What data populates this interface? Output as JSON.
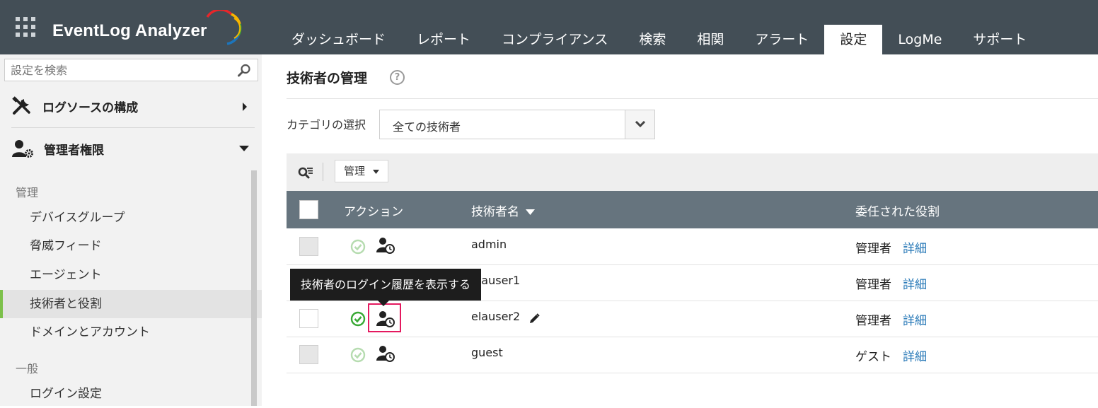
{
  "app": {
    "brand": "EventLog Analyzer",
    "brand_colors": [
      "#e8262a",
      "#f7b500",
      "#39a935",
      "#1c75bc"
    ]
  },
  "nav": {
    "tabs": [
      {
        "label": "ダッシュボード",
        "active": false
      },
      {
        "label": "レポート",
        "active": false
      },
      {
        "label": "コンプライアンス",
        "active": false
      },
      {
        "label": "検索",
        "active": false
      },
      {
        "label": "相関",
        "active": false
      },
      {
        "label": "アラート",
        "active": false
      },
      {
        "label": "設定",
        "active": true
      },
      {
        "label": "LogMe",
        "active": false
      },
      {
        "label": "サポート",
        "active": false
      }
    ]
  },
  "sidebar": {
    "search_placeholder": "設定を検索",
    "sections": [
      {
        "label": "ログソースの構成",
        "icon": "tools-icon",
        "expanded": false
      },
      {
        "label": "管理者権限",
        "icon": "user-gear-icon",
        "expanded": true
      }
    ],
    "groups": [
      {
        "label": "管理",
        "items": [
          "デバイスグループ",
          "脅威フィード",
          "エージェント",
          "技術者と役割",
          "ドメインとアカウント"
        ]
      },
      {
        "label": "一般",
        "items": [
          "ログイン設定"
        ]
      }
    ],
    "active_item": "技術者と役割",
    "accent": "#7cc04a"
  },
  "main": {
    "title": "技術者の管理",
    "help": "?",
    "category_label": "カテゴリの選択",
    "category_value": "全ての技術者",
    "toolbar_manage": "管理",
    "columns": {
      "action": "アクション",
      "name": "技術者名",
      "role": "委任された役割"
    },
    "rows": [
      {
        "name": "admin",
        "role": "管理者",
        "detail": "詳細",
        "enabled": false,
        "editable": false
      },
      {
        "name": "elauser1",
        "role": "管理者",
        "detail": "詳細",
        "enabled": false,
        "editable": false
      },
      {
        "name": "elauser2",
        "role": "管理者",
        "detail": "詳細",
        "enabled": true,
        "editable": true
      },
      {
        "name": "guest",
        "role": "ゲスト",
        "detail": "詳細",
        "enabled": false,
        "editable": false
      }
    ],
    "tooltip": "技術者のログイン履歴を表示する",
    "highlight_color": "#e4195f",
    "link_color": "#2a7ab8"
  }
}
